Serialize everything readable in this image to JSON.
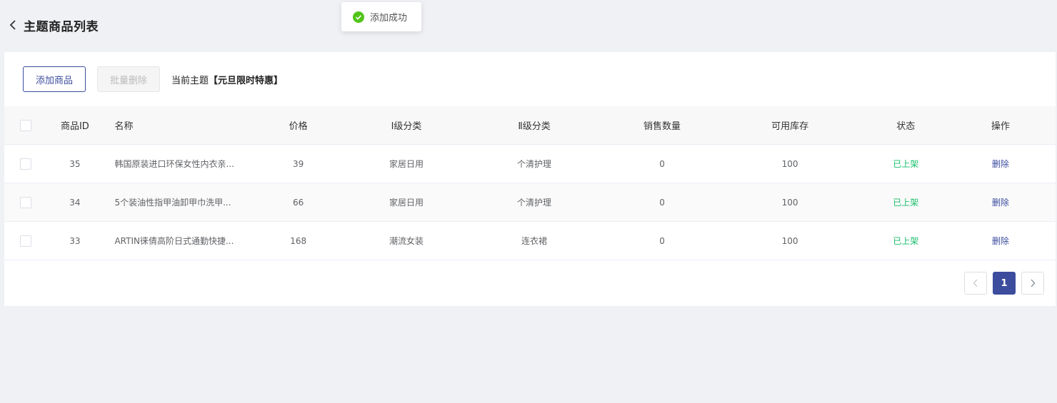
{
  "header": {
    "title": "主题商品列表"
  },
  "toast": {
    "message": "添加成功"
  },
  "toolbar": {
    "add_label": "添加商品",
    "batch_delete_label": "批量删除",
    "theme_prefix": "当前主题",
    "theme_name": "【元旦限时特惠】"
  },
  "table": {
    "columns": [
      "商品ID",
      "名称",
      "价格",
      "Ⅰ级分类",
      "Ⅱ级分类",
      "销售数量",
      "可用库存",
      "状态",
      "操作"
    ],
    "rows": [
      {
        "id": "35",
        "name": "韩国原装进口环保女性内衣亲...",
        "price": "39",
        "cat1": "家居日用",
        "cat2": "个清护理",
        "sales": "0",
        "stock": "100",
        "status": "已上架",
        "op": "删除"
      },
      {
        "id": "34",
        "name": "5个装油性指甲油卸甲巾洗甲...",
        "price": "66",
        "cat1": "家居日用",
        "cat2": "个清护理",
        "sales": "0",
        "stock": "100",
        "status": "已上架",
        "op": "删除"
      },
      {
        "id": "33",
        "name": "ARTIN徕倩高阶日式通勤快捷...",
        "price": "168",
        "cat1": "潮流女装",
        "cat2": "连衣裙",
        "sales": "0",
        "stock": "100",
        "status": "已上架",
        "op": "删除"
      }
    ]
  },
  "pagination": {
    "current": "1"
  },
  "colors": {
    "accent": "#3c4d9e",
    "success": "#19be6b",
    "background": "#f0f1f5"
  }
}
